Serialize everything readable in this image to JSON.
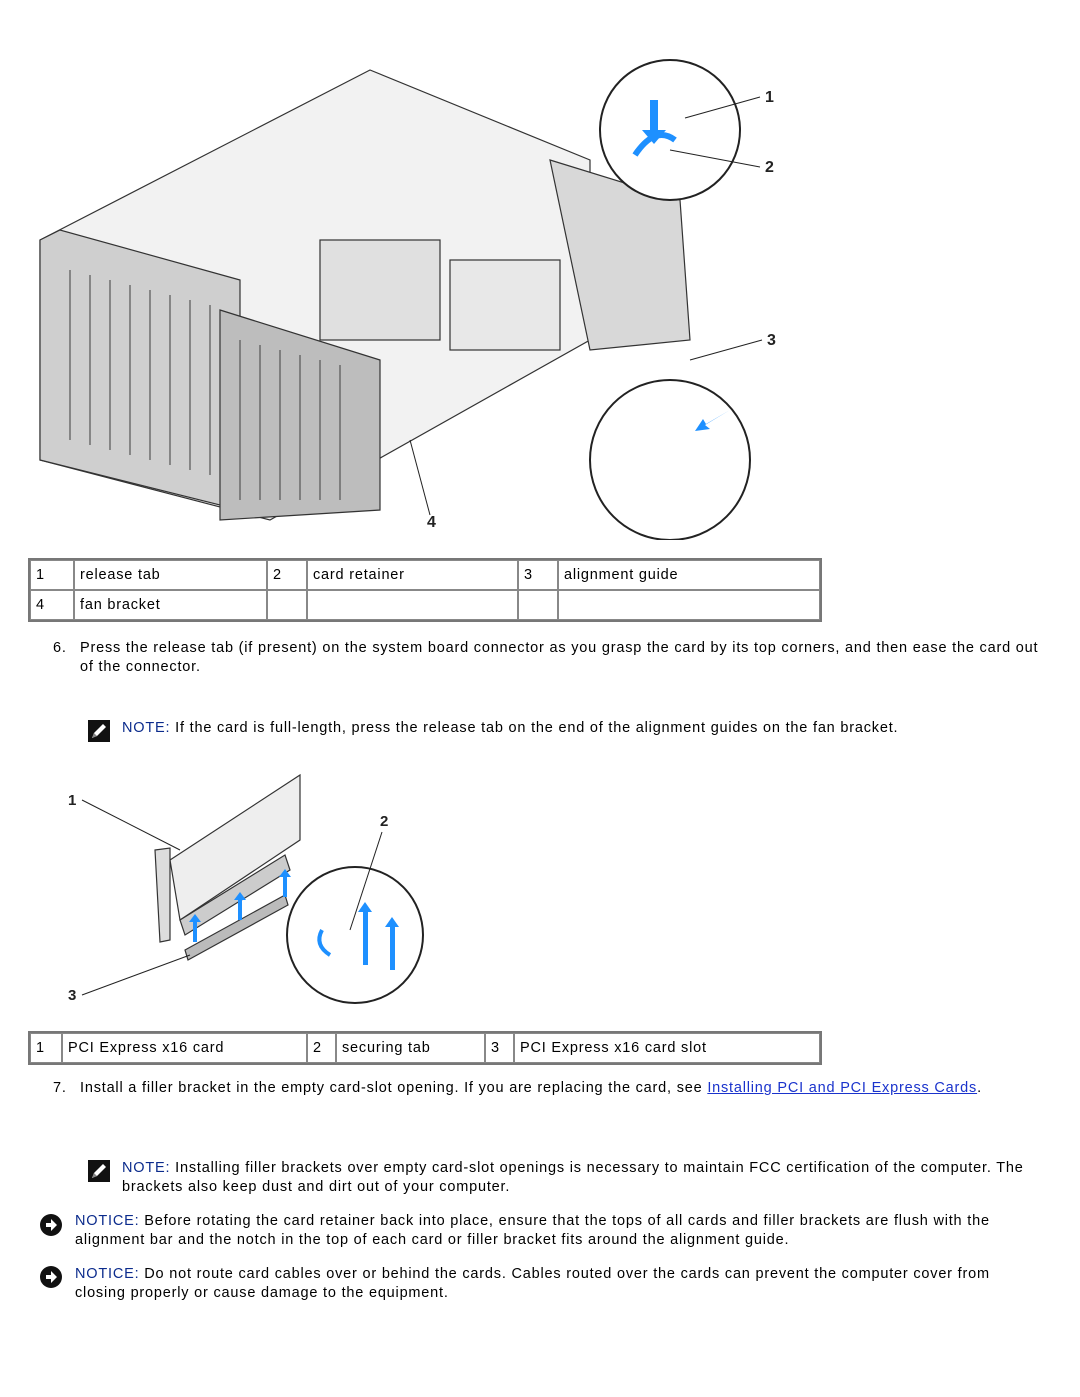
{
  "figure1": {
    "alt": "computer interior with card retainer, fan bracket and alignment guides",
    "callouts": [
      "1",
      "2",
      "3",
      "4"
    ]
  },
  "table1": {
    "rows": [
      [
        {
          "num": "1",
          "label": "release tab"
        },
        {
          "num": "2",
          "label": "card retainer"
        },
        {
          "num": "3",
          "label": "alignment guide"
        }
      ],
      [
        {
          "num": "4",
          "label": "fan bracket"
        },
        {
          "num": "",
          "label": ""
        },
        {
          "num": "",
          "label": ""
        }
      ]
    ]
  },
  "step6": {
    "number": "6.",
    "text": "Press the release tab (if present) on the system board connector as you grasp the card by its top corners, and then ease the card out of the connector."
  },
  "note1": {
    "label": "NOTE:",
    "text": " If the card is full-length, press the release tab on the end of the alignment guides on the fan bracket.",
    "icon": "pencil-note-icon"
  },
  "figure2": {
    "alt": "PCI Express x16 card being removed from slot with securing tab",
    "callouts": [
      "1",
      "2",
      "3"
    ]
  },
  "table2": {
    "rows": [
      [
        {
          "num": "1",
          "label": "PCI Express x16 card"
        },
        {
          "num": "2",
          "label": "securing tab"
        },
        {
          "num": "3",
          "label": "PCI Express x16 card slot"
        }
      ]
    ]
  },
  "step7": {
    "number": "7.",
    "text": "Install a filler bracket in the empty card-slot opening. If you are replacing the card, see ",
    "link": "Installing PCI and PCI Express Cards",
    "after": "."
  },
  "note2": {
    "label": "NOTE:",
    "text": " Installing filler brackets over empty card-slot openings is necessary to maintain FCC certification of the computer. The brackets also keep dust and dirt out of your computer.",
    "icon": "pencil-note-icon"
  },
  "notice1": {
    "label": "NOTICE:",
    "text": " Before rotating the card retainer back into place, ensure that the tops of all cards and filler brackets are flush with the alignment bar and the notch in the top of each card or filler bracket fits around the alignment guide.",
    "icon": "notice-arrow-icon"
  },
  "notice2": {
    "label": "NOTICE:",
    "text": " Do not route card cables over or behind the cards. Cables routed over the cards can prevent the computer cover from closing properly or cause damage to the equipment.",
    "icon": "notice-arrow-icon"
  }
}
